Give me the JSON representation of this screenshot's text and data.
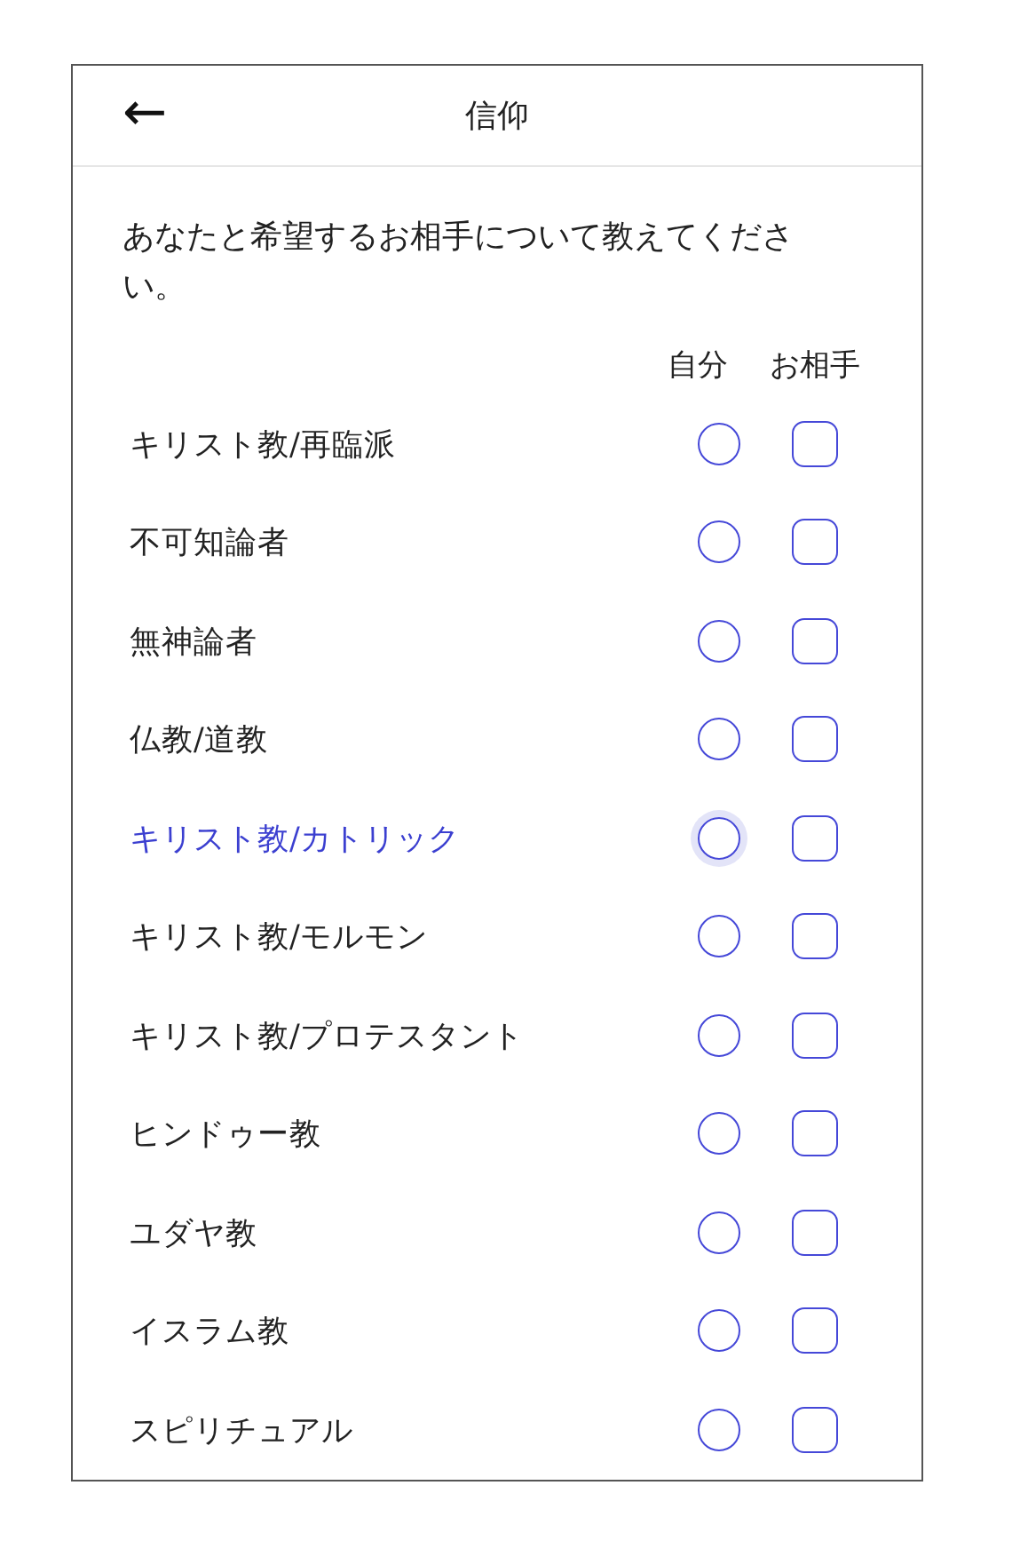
{
  "header": {
    "back": "←",
    "title": "信仰"
  },
  "intro": "あなたと希望するお相手について教えてください。",
  "columns": [
    "自分",
    "お相手"
  ],
  "options": [
    {
      "label": "キリスト教/再臨派",
      "focused": false,
      "self_selected": false,
      "partner_checked": false
    },
    {
      "label": "不可知論者",
      "focused": false,
      "self_selected": false,
      "partner_checked": false
    },
    {
      "label": "無神論者",
      "focused": false,
      "self_selected": false,
      "partner_checked": false
    },
    {
      "label": "仏教/道教",
      "focused": false,
      "self_selected": false,
      "partner_checked": false
    },
    {
      "label": "キリスト教/カトリック",
      "focused": true,
      "self_selected": false,
      "partner_checked": false
    },
    {
      "label": "キリスト教/モルモン",
      "focused": false,
      "self_selected": false,
      "partner_checked": false
    },
    {
      "label": "キリスト教/プロテスタント",
      "focused": false,
      "self_selected": false,
      "partner_checked": false
    },
    {
      "label": "ヒンドゥー教",
      "focused": false,
      "self_selected": false,
      "partner_checked": false
    },
    {
      "label": "ユダヤ教",
      "focused": false,
      "self_selected": false,
      "partner_checked": false
    },
    {
      "label": "イスラム教",
      "focused": false,
      "self_selected": false,
      "partner_checked": false
    },
    {
      "label": "スピリチュアル",
      "focused": false,
      "self_selected": false,
      "partner_checked": false
    }
  ]
}
